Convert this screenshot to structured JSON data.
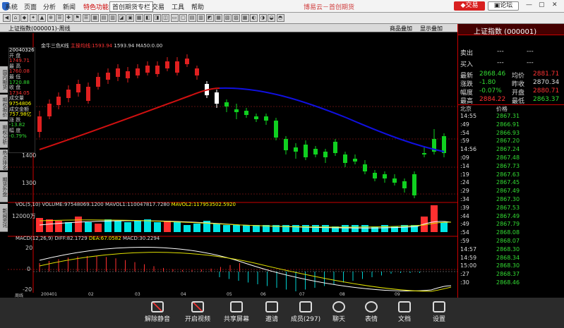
{
  "menu": [
    "系统",
    "页面",
    "分析",
    "新闻",
    "特色功能",
    "首创期货专栏",
    "交易",
    "工具",
    "帮助"
  ],
  "app_title": "博易云－首创期货",
  "trade_btn": "交易",
  "forum_btn": "论坛",
  "toolbar": {
    "symbol_label": "上证指数(000001)-周线",
    "goods_btn": "商品叠加",
    "show_btn": "显示叠加"
  },
  "side_tabs": [
    "国内期货",
    "期权报价",
    "期权分析",
    "热点排名",
    "期货外盘",
    "新闻资讯"
  ],
  "chart_header": {
    "label": "金牛三色K线",
    "main": "主操均线:1593.94",
    "ma_val": "1593.94",
    "ma50": "MA50:0.00"
  },
  "info_box": {
    "date": "20040326",
    "open_label": "开 盘",
    "open": "1749.71",
    "high_label": "最 高",
    "high": "1760.08",
    "low_label": "最 低",
    "low": "1720.88",
    "close_label": "收 盘",
    "close": "1734.05",
    "vol_label": "成交量",
    "vol": "9754806",
    "amt_label": "成交金额",
    "amt": "757.98亿",
    "chg_label": "涨 跌",
    "chg": "-13.82",
    "pct_label": "幅 度",
    "pct": "-0.79%"
  },
  "price_axis": {
    "labels": [
      "1400",
      "1300"
    ]
  },
  "vol_header": {
    "a": "VOL(5,10)",
    "b": "VOLUME:97548069.1200",
    "c": "MAVOL1:110047817.7280",
    "d": "MAVOL2:117953502.5920"
  },
  "vol_axis": "12000万",
  "macd_header": {
    "a": "MACD(12,26,9)",
    "b": "DIFF:82.1729",
    "c": "DEA:67.0582",
    "d": "MACD:30.2294"
  },
  "macd_axis": [
    "20",
    "0",
    "-20"
  ],
  "time_axis": [
    "周线",
    "200401",
    "02",
    "03",
    "04",
    "05",
    "06",
    "07",
    "08",
    "09"
  ],
  "right_panel": {
    "title": "上证指数 (000001)",
    "sell": "卖出",
    "sell_v1": "---",
    "sell_v2": "---",
    "buy": "买入",
    "buy_v1": "---",
    "buy_v2": "---",
    "rows": [
      {
        "l1": "最新",
        "v1": "2868.46",
        "l2": "均价",
        "v2": "2881.71"
      },
      {
        "l1": "涨跌",
        "v1": "-1.80",
        "l2": "昨收",
        "v2": "2870.34"
      },
      {
        "l1": "幅度",
        "v1": "-0.07%",
        "l2": "开盘",
        "v2": "2880.71"
      },
      {
        "l1": "最高",
        "v1": "2884.22",
        "l2": "最低",
        "v2": "2863.37"
      }
    ],
    "tick_header": {
      "loc": "北京",
      "price": "价格"
    },
    "ticks": [
      {
        "t": "14:55",
        "p": "2867.31"
      },
      {
        "t": ":49",
        "p": "2866.91"
      },
      {
        "t": ":54",
        "p": "2866.93"
      },
      {
        "t": ":59",
        "p": "2867.20"
      },
      {
        "t": "14:56",
        "p": "2867.24"
      },
      {
        "t": ":09",
        "p": "2867.48"
      },
      {
        "t": ":14",
        "p": "2867.73"
      },
      {
        "t": ":19",
        "p": "2867.63"
      },
      {
        "t": ":24",
        "p": "2867.45"
      },
      {
        "t": ":29",
        "p": "2867.49"
      },
      {
        "t": ":34",
        "p": "2867.30"
      },
      {
        "t": ":39",
        "p": "2867.53"
      },
      {
        "t": ":44",
        "p": "2867.49"
      },
      {
        "t": ":49",
        "p": "2867.79"
      },
      {
        "t": ":54",
        "p": "2868.08"
      },
      {
        "t": ":59",
        "p": "2868.07"
      },
      {
        "t": "14:57",
        "p": "2868.30"
      },
      {
        "t": "14:59",
        "p": "2868.34"
      },
      {
        "t": "15:00",
        "p": "2868.30"
      },
      {
        "t": ":27",
        "p": "2868.37"
      },
      {
        "t": ":30",
        "p": "2868.46"
      }
    ]
  },
  "meeting": [
    {
      "name": "mute",
      "label": "解除静音"
    },
    {
      "name": "video",
      "label": "开启视频"
    },
    {
      "name": "share",
      "label": "共享屏幕"
    },
    {
      "name": "invite",
      "label": "邀请"
    },
    {
      "name": "members",
      "label": "成员(297)"
    },
    {
      "name": "chat",
      "label": "聊天"
    },
    {
      "name": "emoji",
      "label": "表情"
    },
    {
      "name": "docs",
      "label": "文档"
    },
    {
      "name": "settings",
      "label": "设置"
    }
  ],
  "colors": {
    "up": "#ff2828",
    "down": "#00e0e0",
    "bull": "#e02020",
    "bear": "#10d020",
    "ma": "#d01010",
    "ma2": "#1010e0",
    "accent": "#cc0000"
  }
}
